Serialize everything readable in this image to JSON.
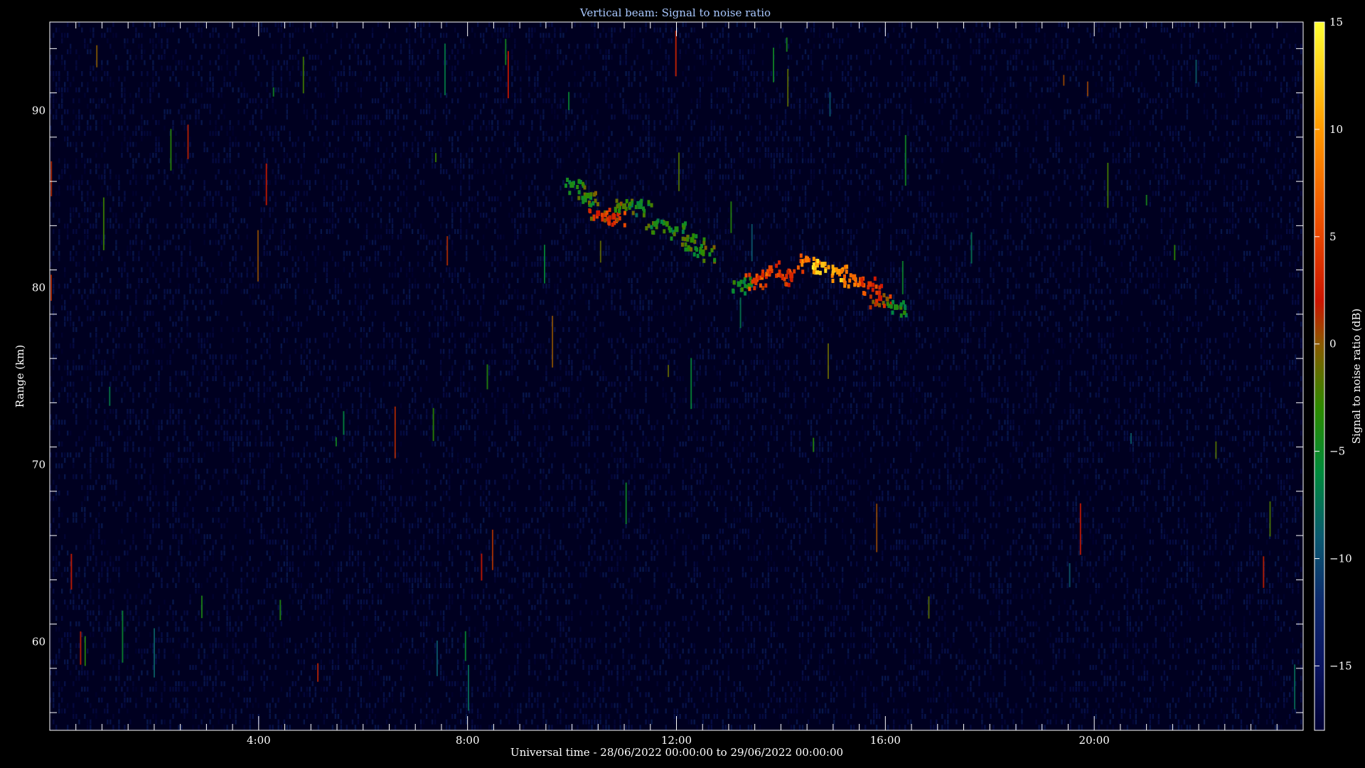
{
  "chart_data": {
    "type": "heatmap",
    "title": "Vertical beam: Signal to noise ratio",
    "xlabel": "Universal time - 28/06/2022 00:00:00 to 29/06/2022 00:00:00",
    "ylabel": "Range (km)",
    "colorbar_label": "Signal to noise ratio (dB)",
    "xlim_hours": [
      0,
      24
    ],
    "ylim_km": [
      55,
      95
    ],
    "x_ticks": [
      {
        "value": 4,
        "label": "4:00"
      },
      {
        "value": 8,
        "label": "8:00"
      },
      {
        "value": 12,
        "label": "12:00"
      },
      {
        "value": 16,
        "label": "16:00"
      },
      {
        "value": 20,
        "label": "20:00"
      }
    ],
    "y_ticks": [
      {
        "value": 60,
        "label": "60"
      },
      {
        "value": 70,
        "label": "70"
      },
      {
        "value": 80,
        "label": "80"
      },
      {
        "value": 90,
        "label": "90"
      }
    ],
    "colorbar_range_db": [
      -18,
      15
    ],
    "colorbar_ticks": [
      {
        "value": 15,
        "label": "15"
      },
      {
        "value": 10,
        "label": "10"
      },
      {
        "value": 5,
        "label": "5"
      },
      {
        "value": 0,
        "label": "0"
      },
      {
        "value": -5,
        "label": "−5"
      },
      {
        "value": -10,
        "label": "−10"
      },
      {
        "value": -15,
        "label": "−15"
      }
    ],
    "colormap": [
      {
        "db": -18,
        "color": "#000033"
      },
      {
        "db": -15,
        "color": "#0a1460"
      },
      {
        "db": -12,
        "color": "#0d2a6e"
      },
      {
        "db": -9,
        "color": "#0b5a70"
      },
      {
        "db": -6,
        "color": "#008a3c"
      },
      {
        "db": -3,
        "color": "#2d8a00"
      },
      {
        "db": 0,
        "color": "#8a5a00"
      },
      {
        "db": 2,
        "color": "#cc1500"
      },
      {
        "db": 6,
        "color": "#ee5500"
      },
      {
        "db": 10,
        "color": "#ff9900"
      },
      {
        "db": 15,
        "color": "#ffff33"
      }
    ],
    "echo_features": [
      {
        "time_h": 10.0,
        "range_km": 85.8,
        "snr_db": -4
      },
      {
        "time_h": 10.3,
        "range_km": 85.2,
        "snr_db": -3
      },
      {
        "time_h": 10.5,
        "range_km": 84.2,
        "snr_db": 2
      },
      {
        "time_h": 10.8,
        "range_km": 84.0,
        "snr_db": 3
      },
      {
        "time_h": 11.0,
        "range_km": 84.6,
        "snr_db": -2
      },
      {
        "time_h": 11.3,
        "range_km": 84.6,
        "snr_db": -5
      },
      {
        "time_h": 11.6,
        "range_km": 83.6,
        "snr_db": -4
      },
      {
        "time_h": 12.0,
        "range_km": 83.3,
        "snr_db": -4
      },
      {
        "time_h": 12.3,
        "range_km": 82.7,
        "snr_db": -3
      },
      {
        "time_h": 12.5,
        "range_km": 82.0,
        "snr_db": -3
      },
      {
        "time_h": 13.2,
        "range_km": 80.2,
        "snr_db": -5
      },
      {
        "time_h": 13.5,
        "range_km": 80.4,
        "snr_db": 4
      },
      {
        "time_h": 13.8,
        "range_km": 81.1,
        "snr_db": 5
      },
      {
        "time_h": 14.2,
        "range_km": 80.7,
        "snr_db": 3
      },
      {
        "time_h": 14.5,
        "range_km": 81.6,
        "snr_db": 8
      },
      {
        "time_h": 14.8,
        "range_km": 81.3,
        "snr_db": 12
      },
      {
        "time_h": 15.1,
        "range_km": 80.9,
        "snr_db": 10
      },
      {
        "time_h": 15.4,
        "range_km": 80.6,
        "snr_db": 7
      },
      {
        "time_h": 15.7,
        "range_km": 80.2,
        "snr_db": 4
      },
      {
        "time_h": 15.9,
        "range_km": 79.4,
        "snr_db": 2
      },
      {
        "time_h": 16.2,
        "range_km": 78.9,
        "snr_db": -4
      }
    ]
  }
}
